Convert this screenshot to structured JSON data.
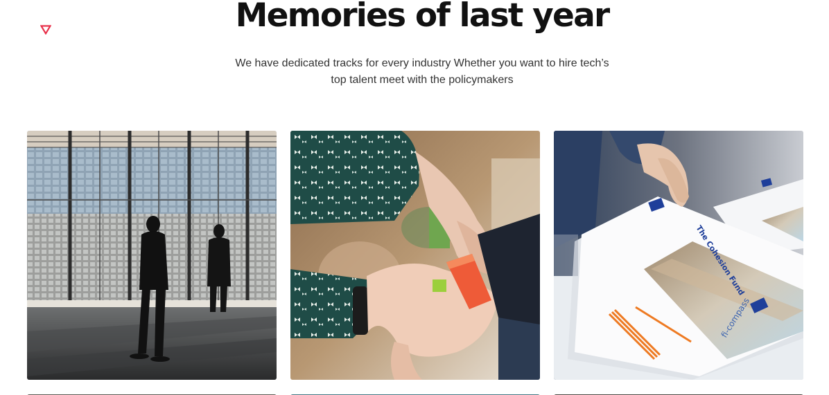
{
  "section": {
    "title": "Memories of last year",
    "subtitle_line1": "We have dedicated tracks for every industry Whether you want to hire tech’s",
    "subtitle_line2": "top talent meet with the policymakers"
  },
  "decoration": {
    "icon": "triangle-down-outline-icon",
    "color": "#e8304a"
  },
  "gallery": {
    "photos": [
      {
        "scene": "business-people-window-photo"
      },
      {
        "scene": "wristband-photo"
      },
      {
        "scene": "brochures-photo"
      }
    ]
  },
  "brochure_text": {
    "title": "The Cohesion Fund",
    "brand": "fi-compass"
  }
}
